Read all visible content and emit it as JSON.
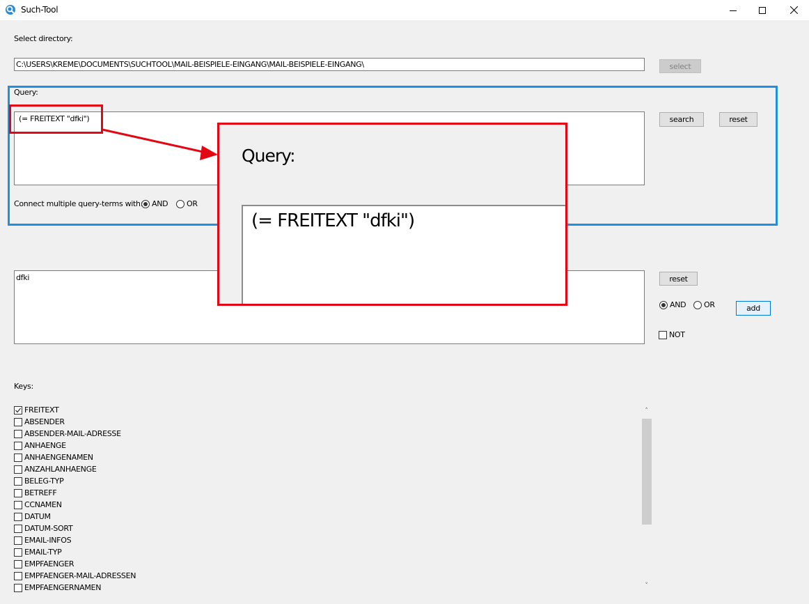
{
  "window": {
    "title": "Such-Tool",
    "minimize_icon": "minimize-icon",
    "maximize_icon": "maximize-icon",
    "close_icon": "close-icon"
  },
  "directory": {
    "label": "Select directory:",
    "path": "C:\\USERS\\KREME\\DOCUMENTS\\SUCHTOOL\\MAIL-BEISPIELE-EINGANG\\MAIL-BEISPIELE-EINGANG\\",
    "select_button": "select"
  },
  "query": {
    "label": "Query:",
    "text": "(= FREITEXT \"dfki\")",
    "search_button": "search",
    "reset_button": "reset",
    "connect_label": "Connect multiple query-terms with:",
    "and_label": "AND",
    "or_label": "OR",
    "selected": "AND"
  },
  "zoom": {
    "label": "Query:",
    "text": "(= FREITEXT \"dfki\")"
  },
  "term": {
    "text": "dfki",
    "reset_button": "reset",
    "and_label": "AND",
    "or_label": "OR",
    "selected": "AND",
    "add_button": "add",
    "not_label": "NOT",
    "not_checked": false
  },
  "keys": {
    "label": "Keys:",
    "items": [
      {
        "label": "FREITEXT",
        "checked": true
      },
      {
        "label": "ABSENDER",
        "checked": false
      },
      {
        "label": "ABSENDER-MAIL-ADRESSE",
        "checked": false
      },
      {
        "label": "ANHAENGE",
        "checked": false
      },
      {
        "label": "ANHAENGENAMEN",
        "checked": false
      },
      {
        "label": "ANZAHLANHAENGE",
        "checked": false
      },
      {
        "label": "BELEG-TYP",
        "checked": false
      },
      {
        "label": "BETREFF",
        "checked": false
      },
      {
        "label": "CCNAMEN",
        "checked": false
      },
      {
        "label": "DATUM",
        "checked": false
      },
      {
        "label": "DATUM-SORT",
        "checked": false
      },
      {
        "label": "EMAIL-INFOS",
        "checked": false
      },
      {
        "label": "EMAIL-TYP",
        "checked": false
      },
      {
        "label": "EMPFAENGER",
        "checked": false
      },
      {
        "label": "EMPFAENGER-MAIL-ADRESSEN",
        "checked": false
      },
      {
        "label": "EMPFAENGERNAMEN",
        "checked": false
      }
    ]
  },
  "colors": {
    "highlight_blue": "#1e8fe1",
    "annotation_red": "#e30613"
  }
}
